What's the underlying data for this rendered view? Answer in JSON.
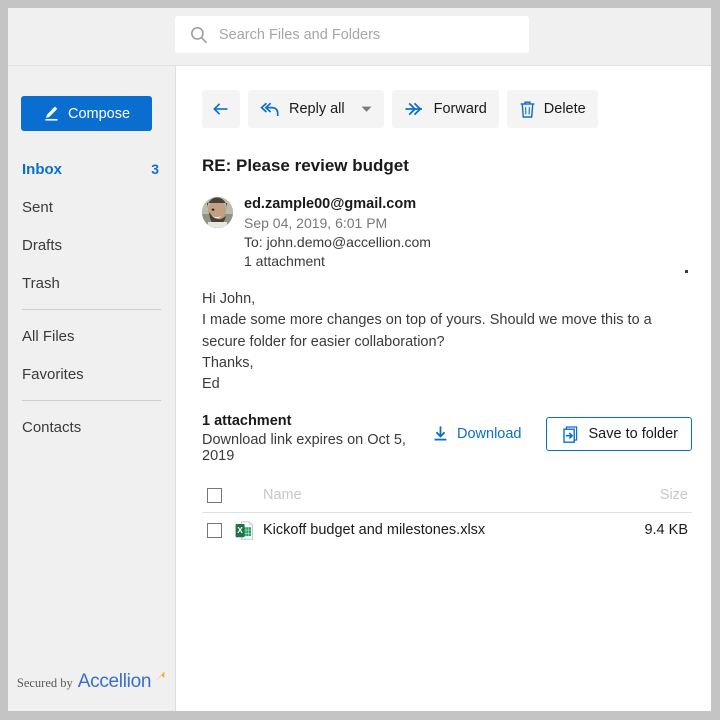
{
  "search": {
    "placeholder": "Search Files and Folders",
    "value": "",
    "icon": "search-icon"
  },
  "sidebar": {
    "compose_label": "Compose",
    "compose_icon": "pencil-icon",
    "items": [
      {
        "label": "Inbox",
        "count": "3",
        "active": true
      },
      {
        "label": "Sent",
        "count": "",
        "active": false
      },
      {
        "label": "Drafts",
        "count": "",
        "active": false
      },
      {
        "label": "Trash",
        "count": "",
        "active": false
      },
      {
        "label": "All Files",
        "count": "",
        "active": false
      },
      {
        "label": "Favorites",
        "count": "",
        "active": false
      },
      {
        "label": "Contacts",
        "count": "",
        "active": false
      }
    ],
    "footer": {
      "secured_by": "Secured by",
      "brand": "Accellion",
      "brand_icon": "accellion-swoosh-icon"
    }
  },
  "toolbar": {
    "back_icon": "arrow-left-icon",
    "reply_all_label": "Reply all",
    "reply_all_icon": "reply-all-icon",
    "reply_all_caret": "chevron-down-icon",
    "forward_label": "Forward",
    "forward_icon": "forward-arrows-icon",
    "delete_label": "Delete",
    "delete_icon": "trash-icon"
  },
  "email": {
    "subject": "RE: Please review budget",
    "sender": "ed.zample00@gmail.com",
    "date": "Sep 04, 2019, 6:01 PM",
    "to": "To: john.demo@accellion.com",
    "attachment_note": "1 attachment",
    "body_lines": [
      "Hi John,",
      "I made some more changes on top of yours. Should we move this to a secure folder for easier collaboration?",
      "Thanks,",
      "Ed"
    ]
  },
  "attachments": {
    "count_label": "1 attachment",
    "expiry_label": "Download link expires on Oct 5, 2019",
    "download_label": "Download",
    "download_icon": "download-icon",
    "save_label": "Save to folder",
    "save_icon": "save-to-folder-icon",
    "columns": {
      "name": "Name",
      "size": "Size"
    },
    "rows": [
      {
        "name": "Kickoff budget and milestones.xlsx",
        "size": "9.4 KB",
        "icon": "excel-file-icon",
        "checked": false
      }
    ]
  },
  "colors": {
    "accent": "#0a6ed1",
    "chrome": "#f0f0f0",
    "brand_blue": "#3b6fc4",
    "brand_orange": "#f5a623",
    "excel_green": "#217346"
  }
}
